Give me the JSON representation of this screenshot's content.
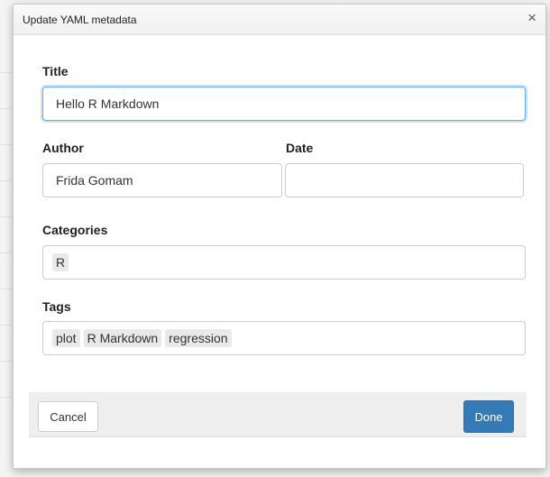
{
  "dialog": {
    "title": "Update YAML metadata",
    "close_symbol": "×"
  },
  "form": {
    "title": {
      "label": "Title",
      "value": "Hello R Markdown"
    },
    "author": {
      "label": "Author",
      "value": "Frida Gomam"
    },
    "date": {
      "label": "Date",
      "value": ""
    },
    "categories": {
      "label": "Categories",
      "items": [
        "R"
      ]
    },
    "tags": {
      "label": "Tags",
      "items": [
        "plot",
        "R Markdown",
        "regression"
      ]
    }
  },
  "footer": {
    "cancel_label": "Cancel",
    "done_label": "Done"
  },
  "colors": {
    "primary": "#337ab7",
    "focus": "#66afe9"
  }
}
